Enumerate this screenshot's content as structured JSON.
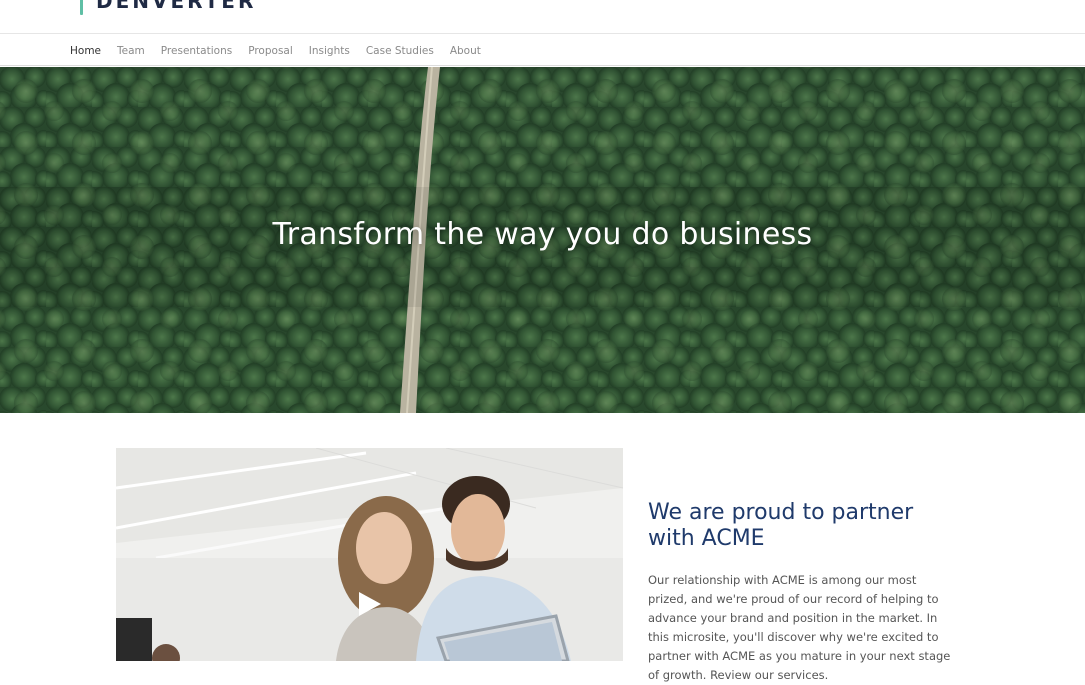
{
  "brand": {
    "name": "DENVERTER",
    "accent": "#5fbfa5",
    "text_color": "#1f2a44"
  },
  "nav": {
    "items": [
      {
        "label": "Home",
        "active": true
      },
      {
        "label": "Team",
        "active": false
      },
      {
        "label": "Presentations",
        "active": false
      },
      {
        "label": "Proposal",
        "active": false
      },
      {
        "label": "Insights",
        "active": false
      },
      {
        "label": "Case Studies",
        "active": false
      },
      {
        "label": "About",
        "active": false
      }
    ]
  },
  "hero": {
    "title": "Transform the way you do business"
  },
  "partner": {
    "heading": "We are proud to partner with ACME",
    "body": "Our relationship with ACME is among our most prized, and we're proud of our record of helping to advance your brand and position in the market. In this microsite, you'll discover why we're excited to partner with ACME as you mature in your next stage of growth. Review our services."
  },
  "video": {
    "play_icon": "play-icon"
  },
  "colors": {
    "heading": "#1f3a6b",
    "body_text": "#555555",
    "nav_active": "#333333",
    "nav_inactive": "#8a8a8a"
  }
}
